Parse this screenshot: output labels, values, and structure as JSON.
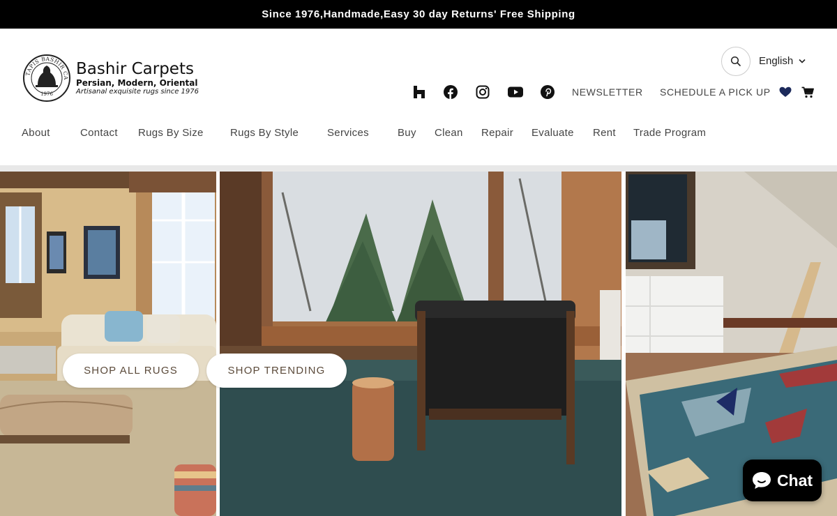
{
  "announcement": "Since 1976,Handmade,Easy 30 day Returns' Free Shipping",
  "brand": {
    "name": "Bashir Carpets",
    "tagline": "Persian, Modern, Oriental",
    "subtagline": "Artisanal exquisite rugs since 1976",
    "seal_text": "TAPIS BASHIR CARPETS",
    "seal_year": "1976"
  },
  "header": {
    "language": "English",
    "newsletter": "NEWSLETTER",
    "schedule": "SCHEDULE A PICK UP"
  },
  "nav": {
    "items": [
      "About",
      "Contact",
      "Rugs By Size",
      "Rugs By Style",
      "Services",
      "Buy",
      "Clean",
      "Repair",
      "Evaluate",
      "Rent",
      "Trade Program"
    ]
  },
  "hero": {
    "shop_all": "SHOP ALL RUGS",
    "shop_trending": "SHOP TRENDING"
  },
  "chat": {
    "label": "Chat"
  },
  "colors": {
    "announcement_bg": "#000000",
    "accent_heart": "#1c2a5b",
    "button_text": "#5b4a3a",
    "chat_bg": "#000000"
  }
}
